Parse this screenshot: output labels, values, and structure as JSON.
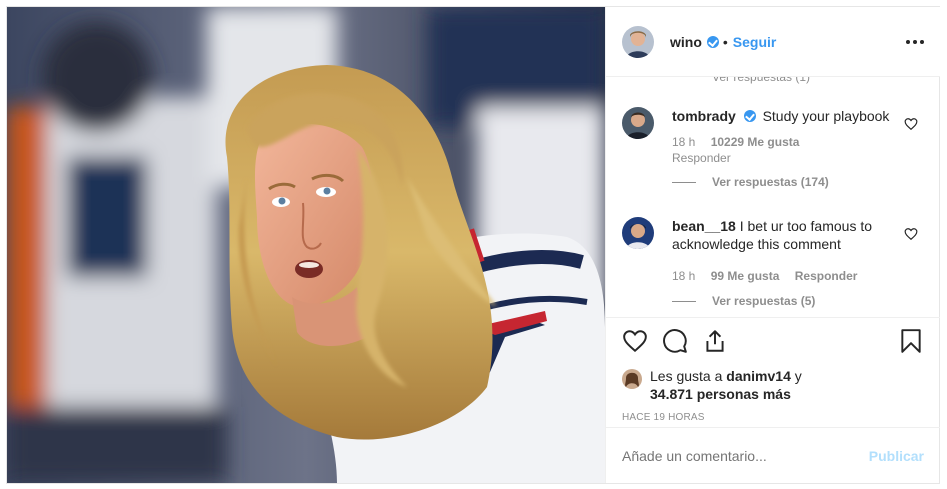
{
  "header": {
    "username": "wino",
    "separator": "•",
    "follow_label": "Seguir"
  },
  "partial_reply_link": "Ver respuestas (1)",
  "comments": [
    {
      "username": "tombrady",
      "verified": true,
      "text": "Study your playbook",
      "time": "18 h",
      "likes": "10229 Me gusta",
      "reply_label": "Responder",
      "view_replies": "Ver respuestas (174)"
    },
    {
      "username": "bean__18",
      "verified": false,
      "text": "I bet ur too famous to acknowledge this comment",
      "time": "18 h",
      "likes": "99 Me gusta",
      "reply_label": "Responder",
      "view_replies": "Ver respuestas (5)"
    }
  ],
  "likes": {
    "prefix": "Les gusta a",
    "user": "danimv14",
    "connector": "y",
    "count": "34.871 personas más"
  },
  "timestamp": "HACE 19 HORAS",
  "add_comment": {
    "placeholder": "Añade un comentario...",
    "publish_label": "Publicar"
  },
  "icons": {
    "more": "more-options-icon",
    "like": "heart-outline-icon",
    "comment": "comment-bubble-icon",
    "share": "share-upload-icon",
    "save": "bookmark-icon",
    "verified": "verified-badge-icon"
  },
  "colors": {
    "link_blue": "#3897f0",
    "publish_disabled": "#b2dffc",
    "muted_text": "#8e8e8e",
    "primary_text": "#262626"
  }
}
